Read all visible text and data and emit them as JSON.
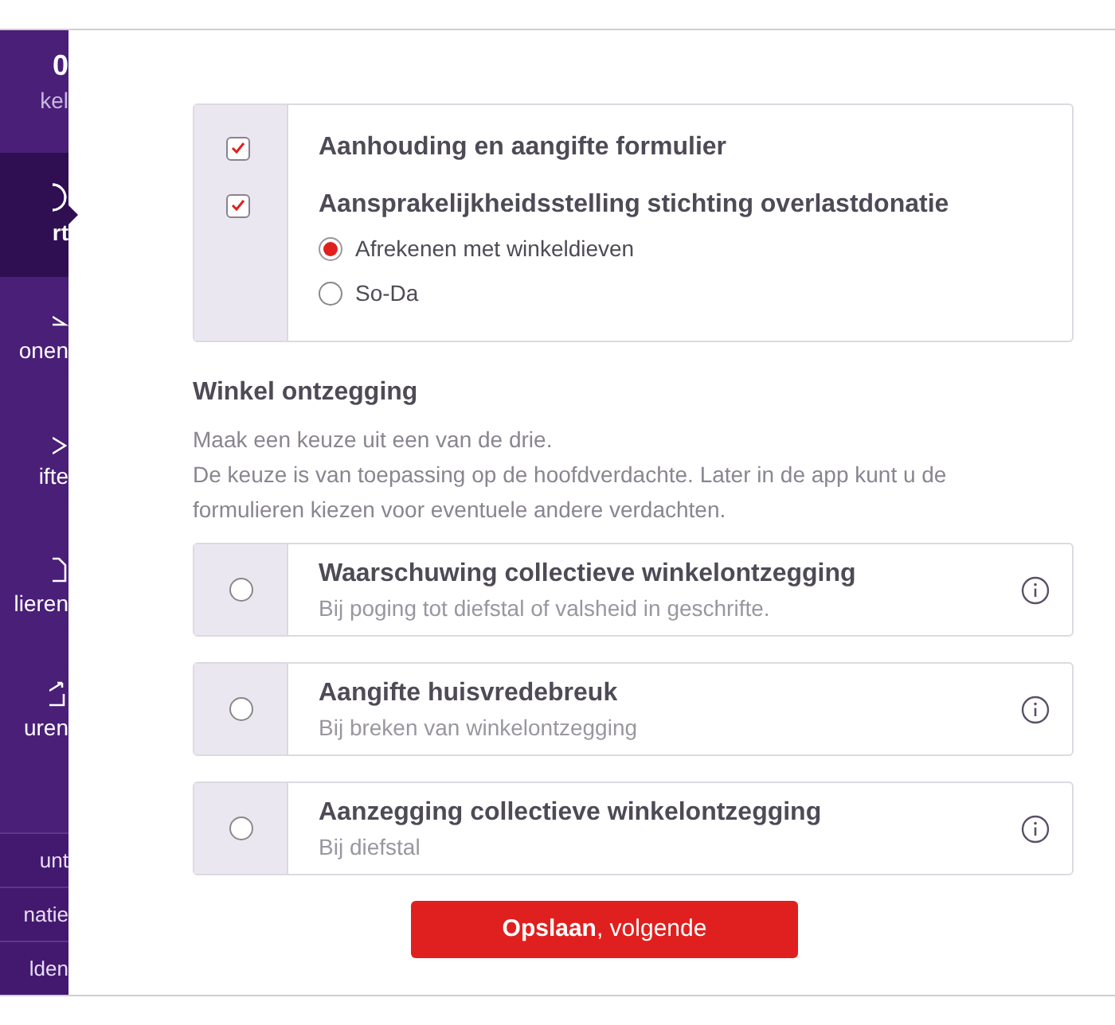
{
  "sidebar": {
    "header": {
      "title": "0",
      "subtitle": "kel"
    },
    "items": [
      {
        "label": "rt",
        "selected": true
      },
      {
        "label": "onen",
        "selected": false
      },
      {
        "label": "ifte",
        "selected": false
      },
      {
        "label": "lieren",
        "selected": false
      },
      {
        "label": "uren",
        "selected": false
      }
    ],
    "footer_links": [
      "unt",
      "natie",
      "lden"
    ]
  },
  "documents": [
    {
      "label": "Aanhouding en aangifte formulier",
      "checked": true
    },
    {
      "label": "Aansprakelijkheidsstelling stichting overlastdonatie",
      "checked": true,
      "options": [
        {
          "label": "Afrekenen met winkeldieven",
          "selected": true
        },
        {
          "label": "So-Da",
          "selected": false
        }
      ]
    }
  ],
  "section": {
    "title": "Winkel ontzegging",
    "description": [
      "Maak een keuze uit een van de drie.",
      "De keuze is van toepassing op de hoofdverdachte. Later in de app kunt u de",
      "formulieren kiezen voor eventuele andere verdachten."
    ]
  },
  "choices": [
    {
      "title": "Waarschuwing collectieve winkelontzegging",
      "subtitle": "Bij poging tot diefstal of valsheid in geschrifte.",
      "selected": false
    },
    {
      "title": "Aangifte huisvredebreuk",
      "subtitle": "Bij breken van winkelontzegging",
      "selected": false
    },
    {
      "title": "Aanzegging collectieve winkelontzegging",
      "subtitle": "Bij diefstal",
      "selected": false
    }
  ],
  "submit": {
    "label": "**Opslaan**, volgende"
  }
}
